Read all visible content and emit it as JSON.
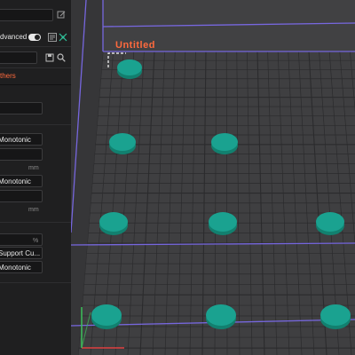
{
  "panel": {
    "advanced_label": "dvanced",
    "advanced_on": true,
    "filament_section_label": "thers",
    "sequence_field_1": "Monotonic",
    "sequence_field_2": "Monotonic",
    "sequence_field_3": "Monotonic",
    "unit_mm_1": "mm",
    "unit_mm_2": "mm",
    "unit_percent": "%",
    "support_field": "Support Cu...",
    "accent_color": "#ff6a3d"
  },
  "viewport": {
    "plate_name": "Untitled",
    "plate_name_color": "#ff6a3d",
    "grid_color": "#2b2b2d",
    "bed_color": "#3f3f41",
    "bounding_box_color": "#7d6cf0",
    "object_color": "#1aa290",
    "object_count": 9,
    "objects": [
      {
        "name": "disc-1",
        "row": 1,
        "col": 1
      },
      {
        "name": "disc-2",
        "row": 2,
        "col": 1
      },
      {
        "name": "disc-3",
        "row": 2,
        "col": 2
      },
      {
        "name": "disc-4",
        "row": 3,
        "col": 1
      },
      {
        "name": "disc-5",
        "row": 3,
        "col": 2
      },
      {
        "name": "disc-6",
        "row": 3,
        "col": 3
      },
      {
        "name": "disc-7",
        "row": 4,
        "col": 1
      },
      {
        "name": "disc-8",
        "row": 4,
        "col": 2
      },
      {
        "name": "disc-9",
        "row": 4,
        "col": 3
      }
    ]
  }
}
